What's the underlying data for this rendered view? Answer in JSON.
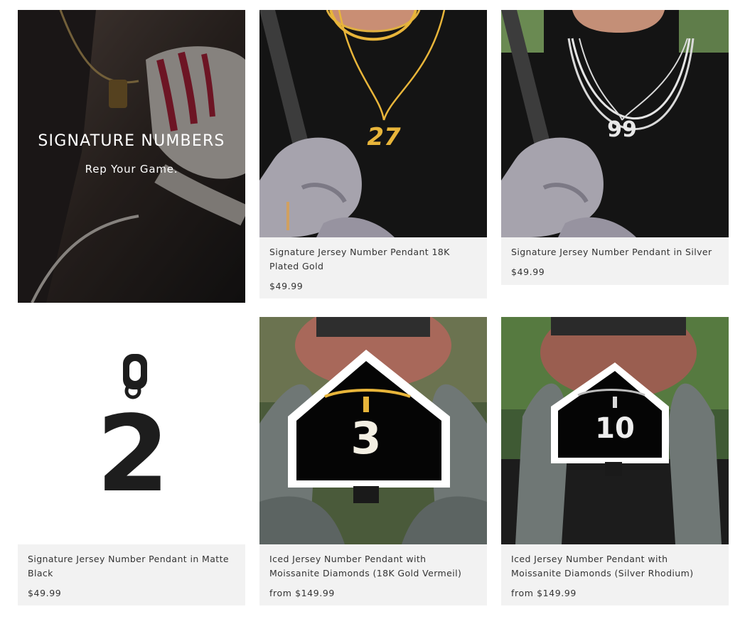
{
  "hero": {
    "title": "SIGNATURE NUMBERS",
    "subtitle": "Rep Your Game."
  },
  "products": [
    {
      "title": "Signature Jersey Number Pendant 18K Plated Gold",
      "price": "$49.99",
      "pendant_number": "27"
    },
    {
      "title": "Signature Jersey Number Pendant in Silver",
      "price": "$49.99",
      "pendant_number": "99"
    },
    {
      "title": "Signature Jersey Number Pendant in Matte Black",
      "price": "$49.99",
      "pendant_number": "2"
    },
    {
      "title": "Iced Jersey Number Pendant with Moissanite Diamonds (18K Gold Vermeil)",
      "price": "from $149.99",
      "pendant_number": "3"
    },
    {
      "title": "Iced Jersey Number Pendant with Moissanite Diamonds (Silver Rhodium)",
      "price": "from $149.99",
      "pendant_number": "10"
    }
  ],
  "colors": {
    "card_background": "#f2f2f2",
    "gold": "#e8b53a",
    "silver": "#d9d9d9",
    "matte_black": "#1d1d1d"
  }
}
